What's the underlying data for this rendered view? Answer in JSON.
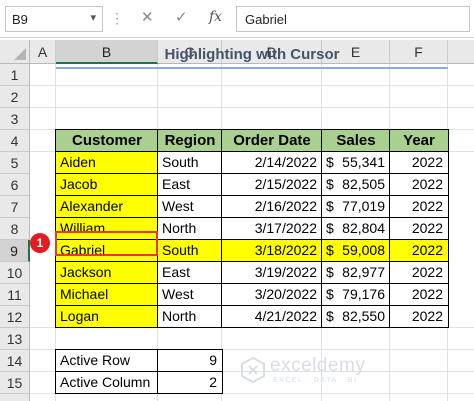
{
  "formula_bar": {
    "name_box": "B9",
    "fx_label": "fx",
    "formula": "Gabriel"
  },
  "columns": [
    "A",
    "B",
    "C",
    "D",
    "E",
    "F"
  ],
  "rows": [
    "1",
    "2",
    "3",
    "4",
    "5",
    "6",
    "7",
    "8",
    "9",
    "10",
    "11",
    "12",
    "13",
    "14",
    "15"
  ],
  "sheet": {
    "title": "Highlighting with Cursor",
    "headers": {
      "customer": "Customer",
      "region": "Region",
      "order_date": "Order Date",
      "sales": "Sales",
      "year": "Year"
    },
    "records": [
      {
        "customer": "Aiden",
        "region": "South",
        "order_date": "2/14/2022",
        "currency": "$",
        "sales": "55,341",
        "year": "2022"
      },
      {
        "customer": "Jacob",
        "region": "East",
        "order_date": "2/15/2022",
        "currency": "$",
        "sales": "82,505",
        "year": "2022"
      },
      {
        "customer": "Alexander",
        "region": "West",
        "order_date": "2/16/2022",
        "currency": "$",
        "sales": "77,019",
        "year": "2022"
      },
      {
        "customer": "William",
        "region": "North",
        "order_date": "3/17/2022",
        "currency": "$",
        "sales": "82,804",
        "year": "2022"
      },
      {
        "customer": "Gabriel",
        "region": "South",
        "order_date": "3/18/2022",
        "currency": "$",
        "sales": "59,008",
        "year": "2022"
      },
      {
        "customer": "Jackson",
        "region": "East",
        "order_date": "3/19/2022",
        "currency": "$",
        "sales": "82,977",
        "year": "2022"
      },
      {
        "customer": "Michael",
        "region": "West",
        "order_date": "3/20/2022",
        "currency": "$",
        "sales": "79,176",
        "year": "2022"
      },
      {
        "customer": "Logan",
        "region": "North",
        "order_date": "4/21/2022",
        "currency": "$",
        "sales": "82,550",
        "year": "2022"
      }
    ],
    "active_row_label": "Active Row",
    "active_row_value": "9",
    "active_column_label": "Active Column",
    "active_column_value": "2"
  },
  "active_cell": "B9",
  "badge": "1",
  "watermark": {
    "name": "exceldemy",
    "tagline": "EXCEL · DATA · BI"
  },
  "colors": {
    "header_fill": "#a9d08e",
    "highlight_yellow": "#ffff00",
    "active_outline": "#e53935",
    "badge": "#e31b23",
    "excel_green": "#217346",
    "title_text": "#44546a"
  },
  "icons": {
    "name_box_dropdown": "chevron-down-icon",
    "cancel": "cancel-x-icon",
    "enter": "checkmark-icon",
    "insert_function": "fx-icon"
  }
}
